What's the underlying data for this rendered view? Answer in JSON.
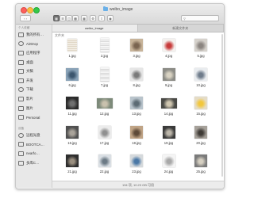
{
  "window": {
    "title": "weibo_image"
  },
  "toolbar": {
    "view_icon_labels": [
      "icon-view",
      "list-view",
      "column-view",
      "cover-flow-view"
    ],
    "search_placeholder": ""
  },
  "tabs": [
    "weibo_image",
    "新建文件夹"
  ],
  "sidebar": {
    "favorites_heading": "个人收藏",
    "items": [
      "我的所有…",
      "AirDrop",
      "应用程序",
      "桌面",
      "文稿",
      "开发",
      "下载",
      "影片",
      "图片",
      "Personal"
    ],
    "devices_heading": "设备",
    "devices": [
      "远程光盘",
      "BOOTCA…",
      "nearfo…",
      "多库C…"
    ]
  },
  "content": {
    "path_label": "文件夹"
  },
  "files": [
    {
      "name": "1.jpg",
      "kind": "doc",
      "color": "#f1ece2",
      "accent": "#cdbfa8"
    },
    {
      "name": "2.jpg",
      "kind": "tall",
      "color": "#f7f7f7",
      "accent": "#bdbdbd"
    },
    {
      "name": "3.jpg",
      "kind": "sq",
      "color": "#c8b49a",
      "accent": "#7a6450"
    },
    {
      "name": "4.jpg",
      "kind": "sq",
      "color": "#f4f1ee",
      "accent": "#c73a3a"
    },
    {
      "name": "5.jpg",
      "kind": "sq",
      "color": "#d6d2cc",
      "accent": "#8b8580"
    },
    {
      "name": "6.jpg",
      "kind": "sq",
      "color": "#8aa3b8",
      "accent": "#3c566e"
    },
    {
      "name": "7.jpg",
      "kind": "tall",
      "color": "#f5f5f5",
      "accent": "#b8b8b8"
    },
    {
      "name": "8.jpg",
      "kind": "sq",
      "color": "#e6e6e6",
      "accent": "#7a7a7a"
    },
    {
      "name": "9.jpg",
      "kind": "sq",
      "color": "#8c8c86",
      "accent": "#d8d2c2"
    },
    {
      "name": "10.jpg",
      "kind": "sq",
      "color": "#e9ecef",
      "accent": "#6f7c8b"
    },
    {
      "name": "11.jpg",
      "kind": "sq",
      "color": "#2b2b2b",
      "accent": "#707070"
    },
    {
      "name": "12.jpg",
      "kind": "wide",
      "color": "#7d8a7a",
      "accent": "#c9c1ad"
    },
    {
      "name": "13.jpg",
      "kind": "sq",
      "color": "#b9c4cc",
      "accent": "#5c6b74"
    },
    {
      "name": "14.jpg",
      "kind": "wide",
      "color": "#4a4a46",
      "accent": "#cfc6b0"
    },
    {
      "name": "15.jpg",
      "kind": "sq",
      "color": "#e5dcc6",
      "accent": "#f2c73c"
    },
    {
      "name": "16.jpg",
      "kind": "sq",
      "color": "#505050",
      "accent": "#a9a39a"
    },
    {
      "name": "17.jpg",
      "kind": "sq",
      "color": "#ececec",
      "accent": "#909090"
    },
    {
      "name": "18.jpg",
      "kind": "sq",
      "color": "#c0a486",
      "accent": "#5e4a38"
    },
    {
      "name": "19.jpg",
      "kind": "sq",
      "color": "#3a3a3a",
      "accent": "#bcb6aa"
    },
    {
      "name": "20.jpg",
      "kind": "sq",
      "color": "#a6a19a",
      "accent": "#3f3b36"
    },
    {
      "name": "21.jpg",
      "kind": "sq",
      "color": "#2e2e2e",
      "accent": "#9a8f80"
    },
    {
      "name": "22.jpg",
      "kind": "sq",
      "color": "#dadfe4",
      "accent": "#6d7b86"
    },
    {
      "name": "23.jpg",
      "kind": "sq",
      "color": "#d5d9dc",
      "accent": "#4a78a6"
    },
    {
      "name": "24.jpg",
      "kind": "sq",
      "color": "#f4f4f4",
      "accent": "#a8a8a8"
    },
    {
      "name": "25.jpg",
      "kind": "sq",
      "color": "#7b7b7b",
      "accent": "#d6d0c2"
    }
  ],
  "status": {
    "text": "194 项, 10.23 GB 可用"
  }
}
